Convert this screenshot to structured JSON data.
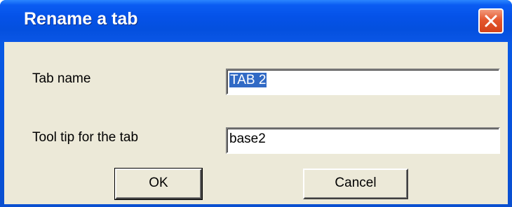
{
  "window": {
    "title": "Rename a tab"
  },
  "titlebar": {
    "close_icon": "close-icon",
    "close_color": "#e4572e"
  },
  "form": {
    "tab_name_label": "Tab name",
    "tab_name_value": "TAB 2",
    "tooltip_label": "Tool tip for the tab",
    "tooltip_value": "base2"
  },
  "buttons": {
    "ok_label": "OK",
    "cancel_label": "Cancel"
  },
  "colors": {
    "titlebar": "#0552e8",
    "client": "#ece9d8",
    "selection": "#316ac5"
  }
}
